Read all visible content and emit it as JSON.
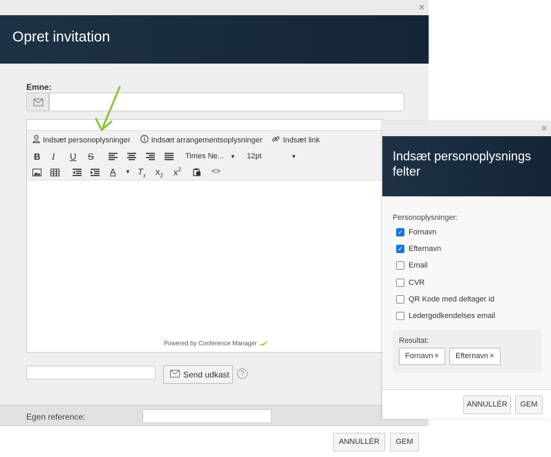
{
  "main": {
    "title": "Opret invitation",
    "close_glyph": "×",
    "subject_label": "Emne:",
    "subject_value": "",
    "toolbar": {
      "insert_person": "Indsæt personoplysninger",
      "insert_event": "Indsæt arrangementsoplysninger",
      "insert_link": "Indsæt link",
      "font_family": "Times Ne...",
      "font_size": "12pt"
    },
    "powered_by": "Powered by Conference Manager",
    "send_draft_label": "Send udkast",
    "reference_label": "Egen reference:",
    "cancel_label": "ANNULLÉR",
    "save_label": "GEM"
  },
  "panel": {
    "title": "Indsæt personoplysnings felter",
    "close_glyph": "×",
    "section_label": "Personoplysninger:",
    "fields": [
      {
        "label": "Fornavn",
        "checked": true
      },
      {
        "label": "Efternavn",
        "checked": true
      },
      {
        "label": "Email",
        "checked": false
      },
      {
        "label": "CVR",
        "checked": false
      },
      {
        "label": "QR Kode med deltager id",
        "checked": false
      },
      {
        "label": "Ledergodkendelses email",
        "checked": false
      }
    ],
    "result_label": "Resultat:",
    "chips": [
      "Fornavn",
      "Efternavn"
    ],
    "cancel_label": "ANNULLÉR",
    "save_label": "GEM"
  },
  "colors": {
    "header": "#1e3246",
    "checkbox": "#1a73e8",
    "arrow": "#8dc63f"
  }
}
